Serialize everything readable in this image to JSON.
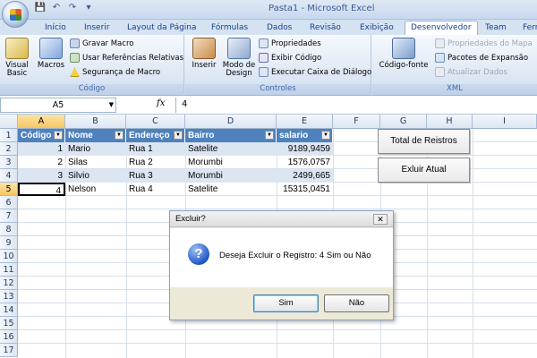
{
  "titlebar": {
    "title": "Pasta1 - Microsoft Excel",
    "qat": [
      "save-icon",
      "undo-icon",
      "redo-icon",
      "dropdown-icon"
    ],
    "qat_glyphs": [
      "💾",
      "↶",
      "↷",
      "▾"
    ]
  },
  "tabs": [
    "Início",
    "Inserir",
    "Layout da Página",
    "Fórmulas",
    "Dados",
    "Revisão",
    "Exibição",
    "Desenvolvedor",
    "Team",
    "Ferr"
  ],
  "active_tab": "Desenvolvedor",
  "ribbon": {
    "codigo": {
      "label": "Código",
      "visual_basic": "Visual Basic",
      "macros": "Macros",
      "gravar_macro": "Gravar Macro",
      "usar_ref": "Usar Referências Relativas",
      "seguranca": "Segurança de Macro"
    },
    "controles": {
      "label": "Controles",
      "inserir": "Inserir",
      "modo_design": "Modo de Design",
      "propriedades": "Propriedades",
      "exibir_codigo": "Exibir Código",
      "executar_caixa": "Executar Caixa de Diálogo"
    },
    "xml": {
      "label": "XML",
      "codigo_fonte": "Código-fonte",
      "propriedades_mapa": "Propriedades do Mapa",
      "pacotes_expansao": "Pacotes de Expansão",
      "atualizar_dados": "Atualizar Dados"
    }
  },
  "formula_bar": {
    "name_box": "A5",
    "fx": "fx",
    "value": "4"
  },
  "columns": [
    "A",
    "B",
    "C",
    "D",
    "E",
    "F",
    "G",
    "H",
    "I"
  ],
  "rows": [
    "1",
    "2",
    "3",
    "4",
    "5",
    "6",
    "7",
    "8",
    "9",
    "10",
    "11",
    "12",
    "13",
    "14",
    "15",
    "16",
    "17"
  ],
  "table": {
    "headers": [
      "Código",
      "Nome",
      "Endereço",
      "Bairro",
      "salario"
    ],
    "rows": [
      [
        "1",
        "Mario",
        "Rua 1",
        "Satelite",
        "9189,9459"
      ],
      [
        "2",
        "Silas",
        "Rua 2",
        "Morumbi",
        "1576,0757"
      ],
      [
        "3",
        "Silvio",
        "Rua 3",
        "Morumbi",
        "2499,665"
      ],
      [
        "4",
        "Nelson",
        "Rua 4",
        "Satelite",
        "15315,0451"
      ]
    ]
  },
  "sheet_buttons": {
    "total": "Total de Reistros",
    "excluir": "Exluir Atual"
  },
  "dialog": {
    "title": "Excluir?",
    "message": "Deseja Excluir o Registro: 4 Sim ou Não",
    "yes": "Sim",
    "no": "Não",
    "close": "✕",
    "icon": "question-icon",
    "icon_glyph": "?"
  },
  "colors": {
    "accent": "#4f81bd",
    "band": "#dce6f2",
    "selected_header": "#f6c662"
  }
}
